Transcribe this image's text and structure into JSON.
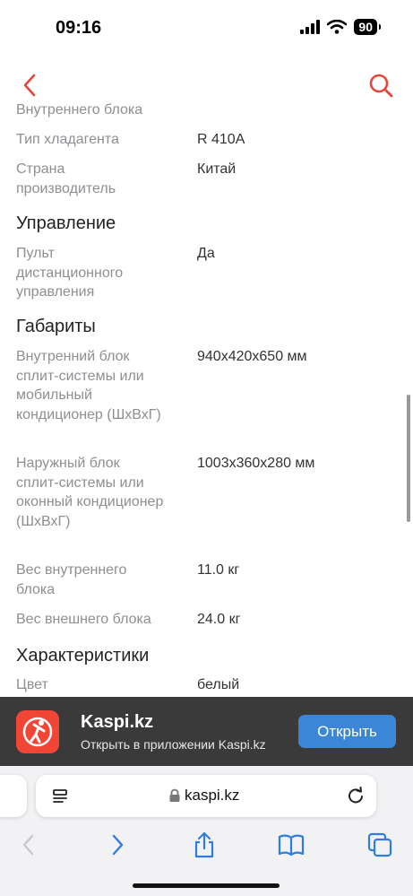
{
  "status": {
    "time": "09:16",
    "battery": "90"
  },
  "nav": {
    "back_icon": "chevron-left-icon",
    "search_icon": "search-icon",
    "accent": "#e3463b"
  },
  "specs": {
    "partial_key": "Внутреннего блока",
    "rows1": [
      {
        "k": "Тип хладагента",
        "v": "R 410A"
      },
      {
        "k": "Страна производитель",
        "v": "Китай"
      }
    ],
    "section_control": "Управление",
    "rows2": [
      {
        "k": "Пульт дистанционного управления",
        "v": "Да"
      }
    ],
    "section_dims": "Габариты",
    "rows3": [
      {
        "k": "Внутренний блок сплит-системы или мобильный кондиционер (ШхВхГ)",
        "v": "940x420x650 мм"
      },
      {
        "k": "Наружный блок сплит-системы или оконный кондиционер (ШхВхГ)",
        "v": "1003x360x280 мм"
      },
      {
        "k": "Вес внутреннего блока",
        "v": "11.0 кг"
      },
      {
        "k": "Вес внешнего блока",
        "v": "24.0 кг"
      }
    ],
    "section_chars": "Характеристики",
    "rows4": [
      {
        "k": "Цвет",
        "v": "белый"
      }
    ]
  },
  "banner": {
    "title": "Kaspi.kz",
    "subtitle": "Открыть в приложении Kaspi.kz",
    "button": "Открыть",
    "button_color": "#3b86d6",
    "icon_color": "#f14635"
  },
  "browser": {
    "url": "kaspi.kz"
  }
}
